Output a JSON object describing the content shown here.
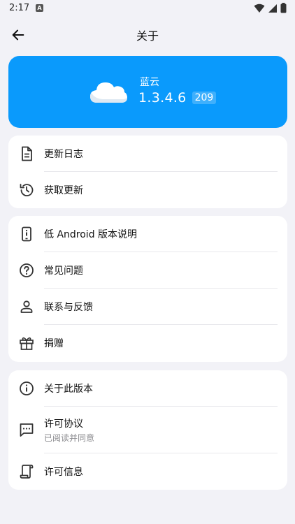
{
  "status_bar": {
    "time": "2:17",
    "notification_letter": "A"
  },
  "app_bar": {
    "title": "关于"
  },
  "hero": {
    "app_name": "蓝云",
    "version": "1.3.4.6",
    "build": "209"
  },
  "sections": [
    {
      "items": [
        {
          "label": "更新日志",
          "icon": "document-icon"
        },
        {
          "label": "获取更新",
          "icon": "history-icon"
        }
      ]
    },
    {
      "items": [
        {
          "label": "低 Android 版本说明",
          "icon": "phone-info-icon"
        },
        {
          "label": "常见问题",
          "icon": "help-circle-icon"
        },
        {
          "label": "联系与反馈",
          "icon": "person-icon"
        },
        {
          "label": "捐赠",
          "icon": "gift-icon"
        }
      ]
    },
    {
      "items": [
        {
          "label": "关于此版本",
          "icon": "info-circle-icon"
        },
        {
          "label": "许可协议",
          "sublabel": "已阅读并同意",
          "icon": "message-dots-icon"
        },
        {
          "label": "许可信息",
          "icon": "scroll-icon"
        }
      ]
    }
  ],
  "colors": {
    "accent": "#0a9afc",
    "background": "#f2f2f7",
    "card": "#ffffff"
  }
}
